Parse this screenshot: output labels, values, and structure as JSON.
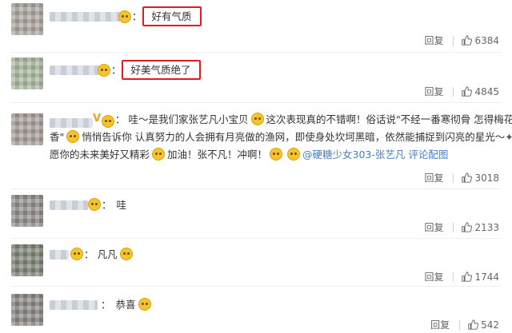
{
  "reply_label": "回复",
  "comments": [
    {
      "text": "好有气质",
      "likes": "6384"
    },
    {
      "text": "好美气质绝了",
      "likes": "4845"
    },
    {
      "line1": "哇～是我们家张艺凡小宝贝",
      "line1b": "这次表现真的不错啊！俗话说\"不经一番寒彻骨 怎得梅花扑鼻",
      "line2a": "香\"",
      "line2b": "悄悄告诉你 认真努力的人会拥有月亮做的渔网，即使身处坎坷黑暗，依然能捕捉到闪亮的星光～",
      "line3a": "愿你的未来美好又精彩",
      "line3b": "加油！张不凡！冲啊！",
      "source_link": "@硬糖少女303-张艺凡 评论配图",
      "likes": "3018"
    },
    {
      "text": "哇",
      "likes": "2133"
    },
    {
      "text": "凡凡",
      "likes": "1744"
    },
    {
      "text": "恭喜",
      "likes": "542"
    }
  ],
  "colors": {
    "highlight": "#e31b23",
    "link": "#4a7dbf"
  }
}
